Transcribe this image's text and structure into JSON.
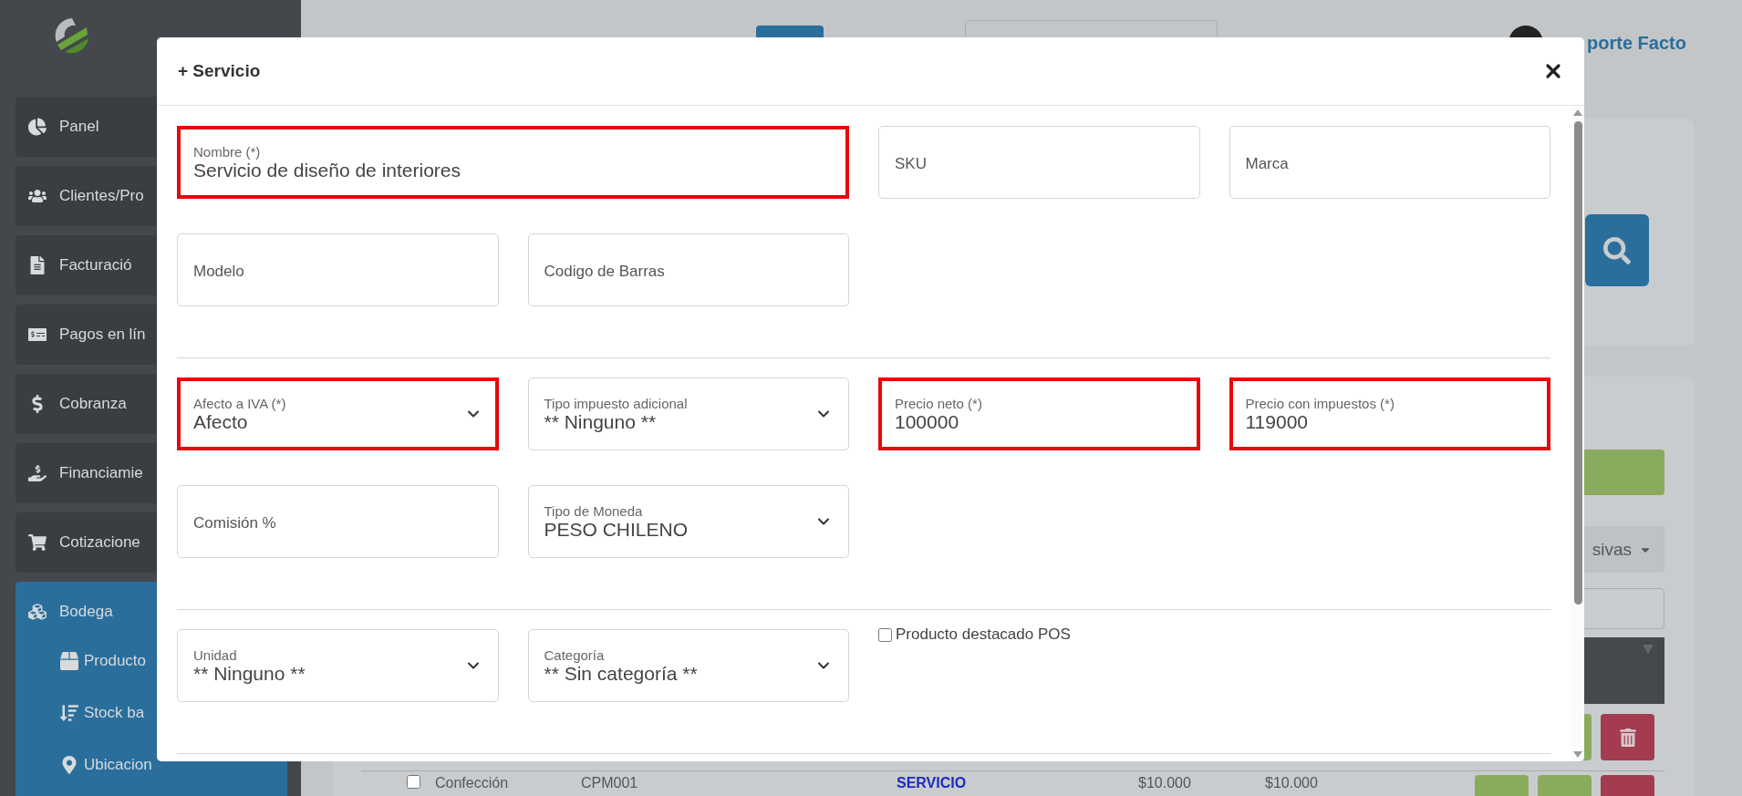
{
  "sidebar": {
    "items": [
      {
        "label": "Panel",
        "selected": false
      },
      {
        "label": "Clientes/Pro",
        "selected": false
      },
      {
        "label": "Facturació",
        "selected": false
      },
      {
        "label": "Pagos en lín",
        "selected": false
      },
      {
        "label": "Cobranza",
        "selected": false
      },
      {
        "label": "Financiamie",
        "selected": false
      },
      {
        "label": "Cotizacione",
        "selected": false
      },
      {
        "label": "Bodega",
        "selected": true,
        "expanded": true,
        "children": [
          {
            "label": "Producto"
          },
          {
            "label": "Stock ba"
          },
          {
            "label": "Ubicacion"
          }
        ]
      }
    ]
  },
  "topbar": {
    "user": "porte Facto"
  },
  "list": {
    "bulk_button": "sivas",
    "rows": [
      {
        "checked": false,
        "column_1": "Confección",
        "column_2": "CPM001",
        "column_3": "SERVICIO",
        "column_4": "$10.000",
        "column_5": "$10.000"
      }
    ]
  },
  "modal": {
    "title": "+ Servicio",
    "sections": [
      {
        "fields": [
          {
            "kind": "text",
            "label": "Nombre (*)",
            "value": "Servicio de diseño de interiores",
            "highlighted": true,
            "wide": true
          },
          {
            "kind": "text",
            "placeholder": "SKU",
            "highlighted": false,
            "wide": false
          },
          {
            "kind": "text",
            "placeholder": "Marca",
            "highlighted": false,
            "wide": false
          },
          {
            "kind": "text",
            "placeholder": "Modelo",
            "highlighted": false,
            "wide": false
          },
          {
            "kind": "text",
            "placeholder": "Codigo de Barras",
            "highlighted": false,
            "wide": false
          }
        ]
      },
      {
        "fields": [
          {
            "kind": "select",
            "label": "Afecto a IVA (*)",
            "value": "Afecto",
            "highlighted": true,
            "wide": false
          },
          {
            "kind": "select",
            "label": "Tipo impuesto adicional",
            "value": "** Ninguno **",
            "highlighted": false,
            "wide": false
          },
          {
            "kind": "text",
            "label": "Precio neto (*)",
            "value": "100000",
            "highlighted": true,
            "wide": false
          },
          {
            "kind": "text",
            "label": "Precio con impuestos (*)",
            "value": "119000",
            "highlighted": true,
            "wide": false
          },
          {
            "kind": "text",
            "placeholder": "Comisión %",
            "highlighted": false,
            "wide": false
          },
          {
            "kind": "select",
            "label": "Tipo de Moneda",
            "value": "PESO CHILENO",
            "highlighted": false,
            "wide": false
          }
        ]
      },
      {
        "fields": [
          {
            "kind": "select",
            "label": "Unidad",
            "value": "** Ninguno **",
            "highlighted": false,
            "wide": false
          },
          {
            "kind": "select",
            "label": "Categoría",
            "value": "** Sin categoría **",
            "highlighted": false,
            "wide": false
          },
          {
            "kind": "checkbox",
            "label": "Producto destacado POS",
            "checked": false
          }
        ]
      }
    ]
  }
}
